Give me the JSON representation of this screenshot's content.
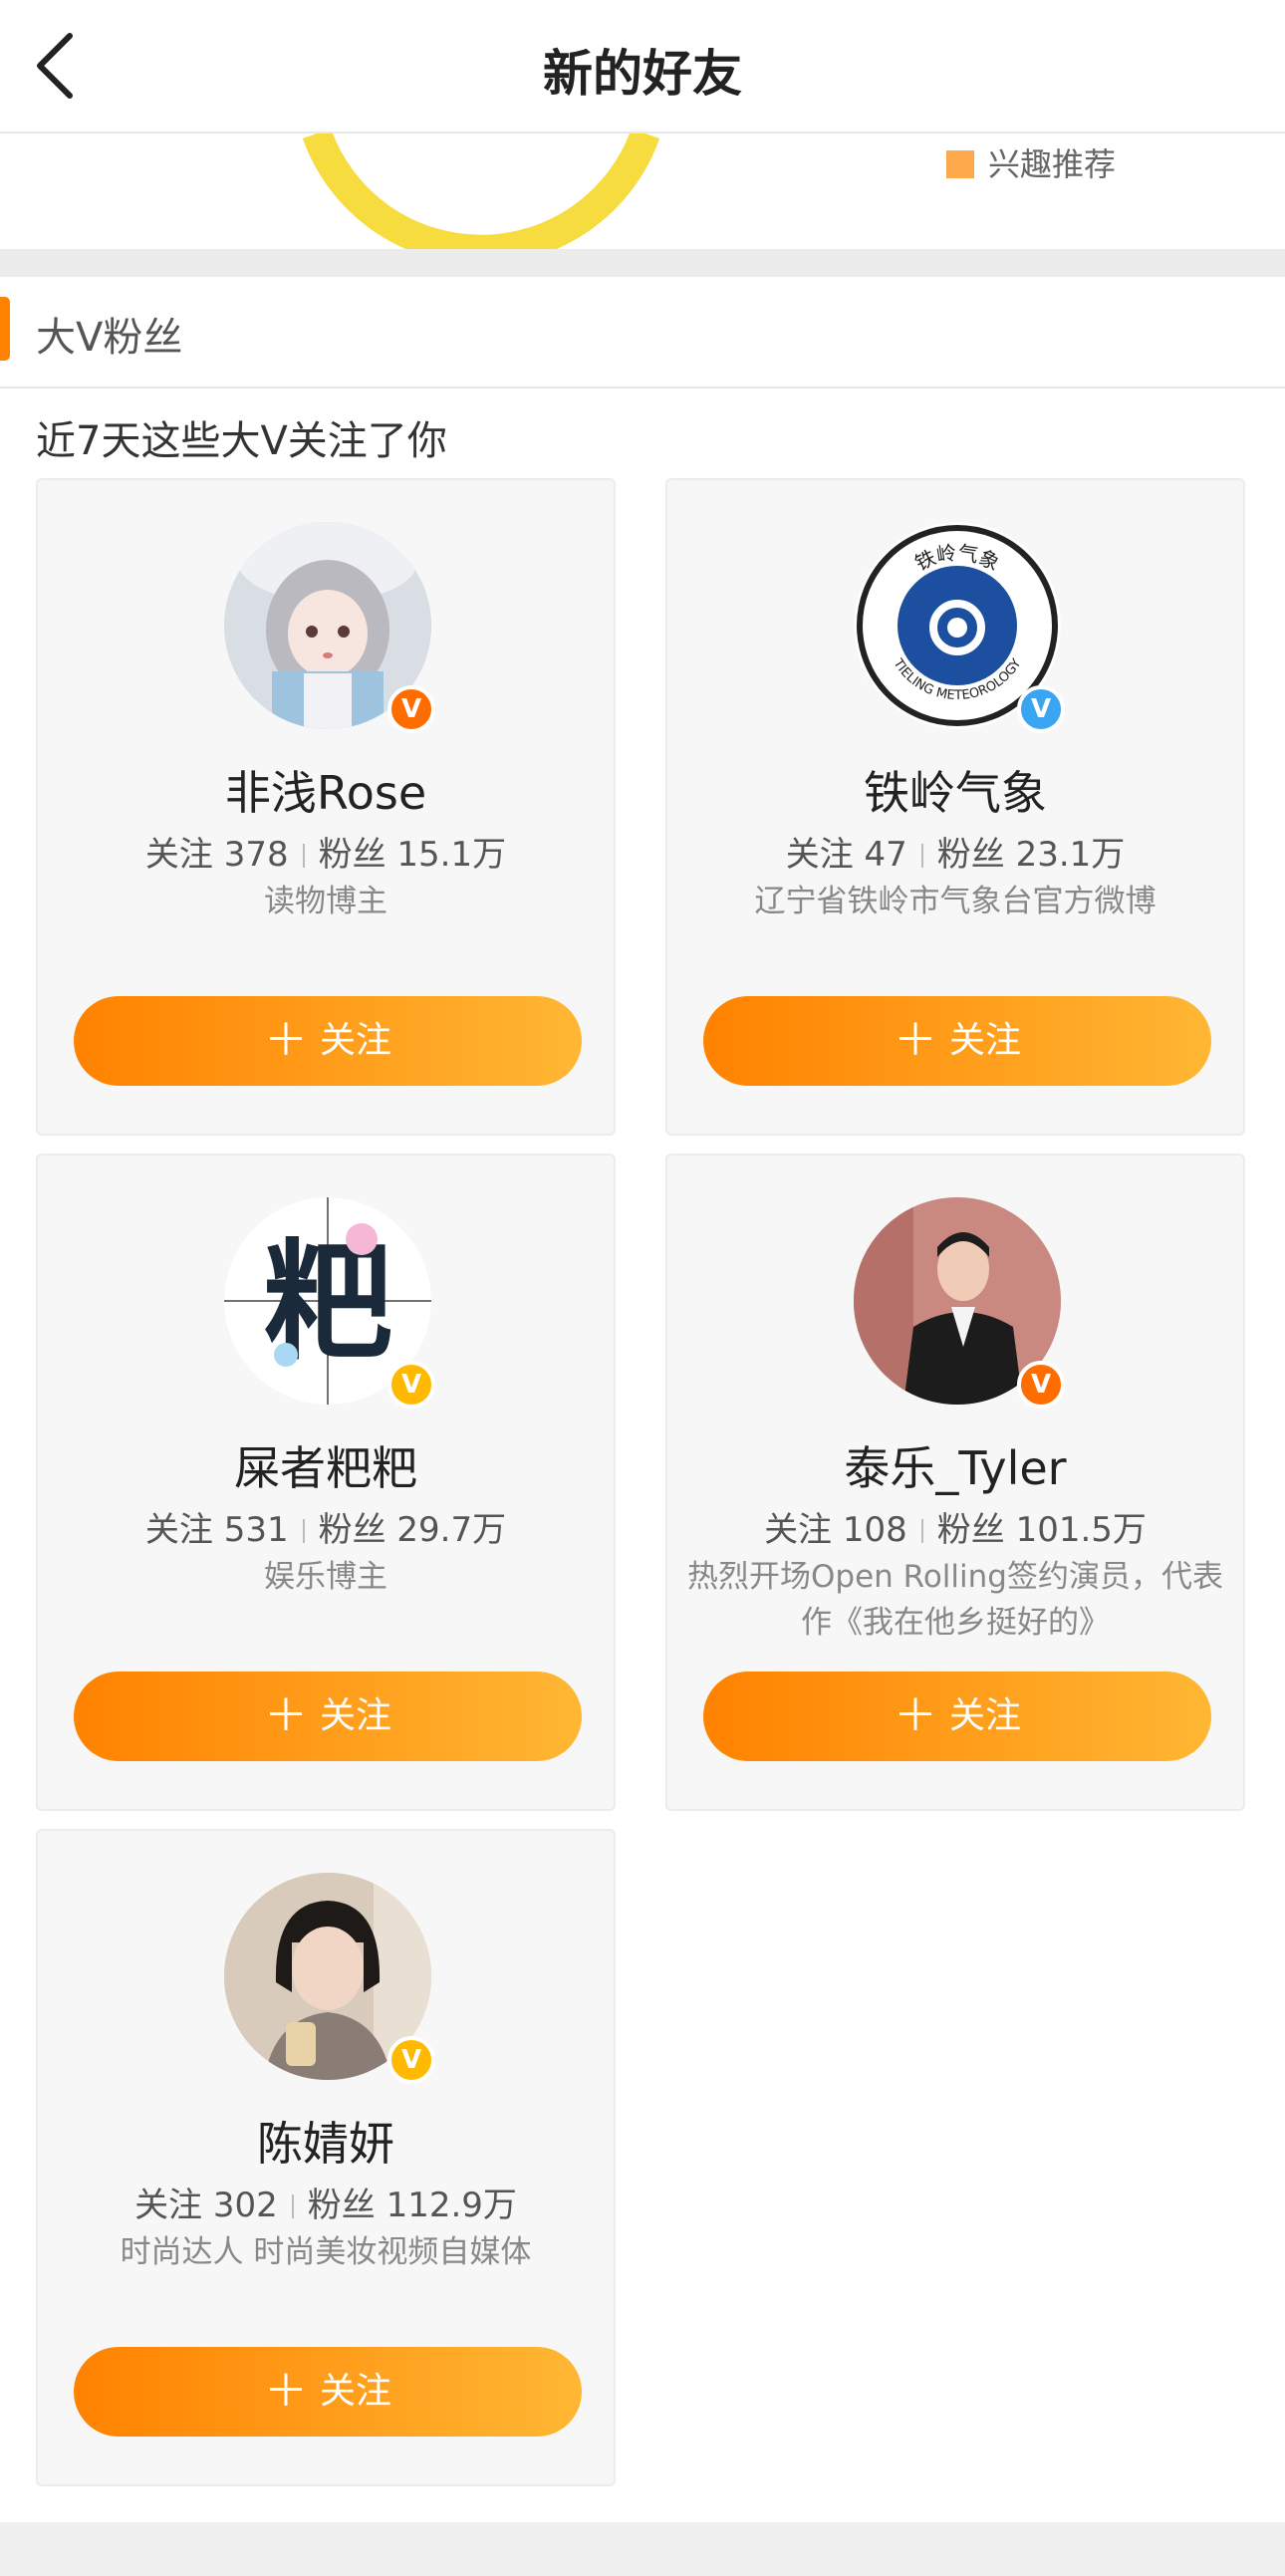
{
  "header": {
    "title": "新的好友"
  },
  "legend": {
    "label": "兴趣推荐",
    "color": "#ffa94d"
  },
  "section": {
    "title": "大V粉丝",
    "subtitle": "近7天这些大V关注了你"
  },
  "labels": {
    "following": "关注",
    "fans": "粉丝",
    "follow_button": "关注",
    "plus": "＋",
    "badge": "V"
  },
  "cards": [
    {
      "name": "非浅Rose",
      "following": "378",
      "fans": "15.1万",
      "desc": "读物博主",
      "badge_color": "orange"
    },
    {
      "name": "铁岭气象",
      "following": "47",
      "fans": "23.1万",
      "desc": "辽宁省铁岭市气象台官方微博",
      "badge_color": "blue",
      "avatar_text": {
        "top": "铁岭气象",
        "bottom": "TIELING METEOROLOGY"
      }
    },
    {
      "name": "屎者粑粑",
      "following": "531",
      "fans": "29.7万",
      "desc": "娱乐博主",
      "badge_color": "yellow",
      "avatar_text": {
        "glyph": "粑"
      }
    },
    {
      "name": "泰乐_Tyler",
      "following": "108",
      "fans": "101.5万",
      "desc": "热烈开场Open Rolling签约演员，代表作《我在他乡挺好的》",
      "badge_color": "orange"
    },
    {
      "name": "陈婧妍",
      "following": "302",
      "fans": "112.9万",
      "desc": "时尚达人 时尚美妆视频自媒体",
      "badge_color": "yellow"
    }
  ],
  "colors": {
    "accent": "#ff8200",
    "accent_light": "#ffb734",
    "card_bg": "#f7f7f7"
  }
}
